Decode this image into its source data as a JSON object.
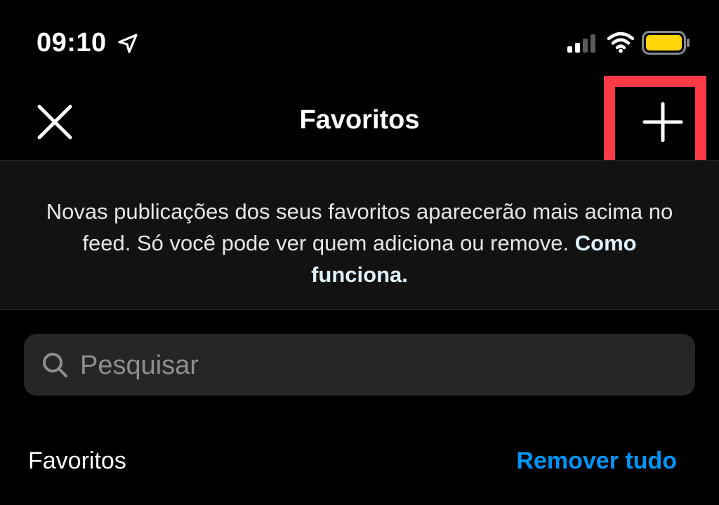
{
  "status_bar": {
    "time": "09:10",
    "icons": [
      "location-arrow-icon",
      "signal-icon",
      "wifi-icon",
      "battery-icon"
    ],
    "battery_color": "#ffd60a"
  },
  "nav": {
    "title": "Favoritos",
    "close_icon": "close-icon",
    "add_icon": "plus-icon"
  },
  "highlight": {
    "color": "#ff3b48"
  },
  "info_banner": {
    "text": "Novas publicações dos seus favoritos aparecerão mais acima no feed. Só você pode ver quem adiciona ou remove. ",
    "link_label": "Como funciona."
  },
  "search": {
    "placeholder": "Pesquisar",
    "value": ""
  },
  "section": {
    "title": "Favoritos",
    "remove_all_label": "Remover tudo",
    "accent_color": "#0095f6"
  }
}
